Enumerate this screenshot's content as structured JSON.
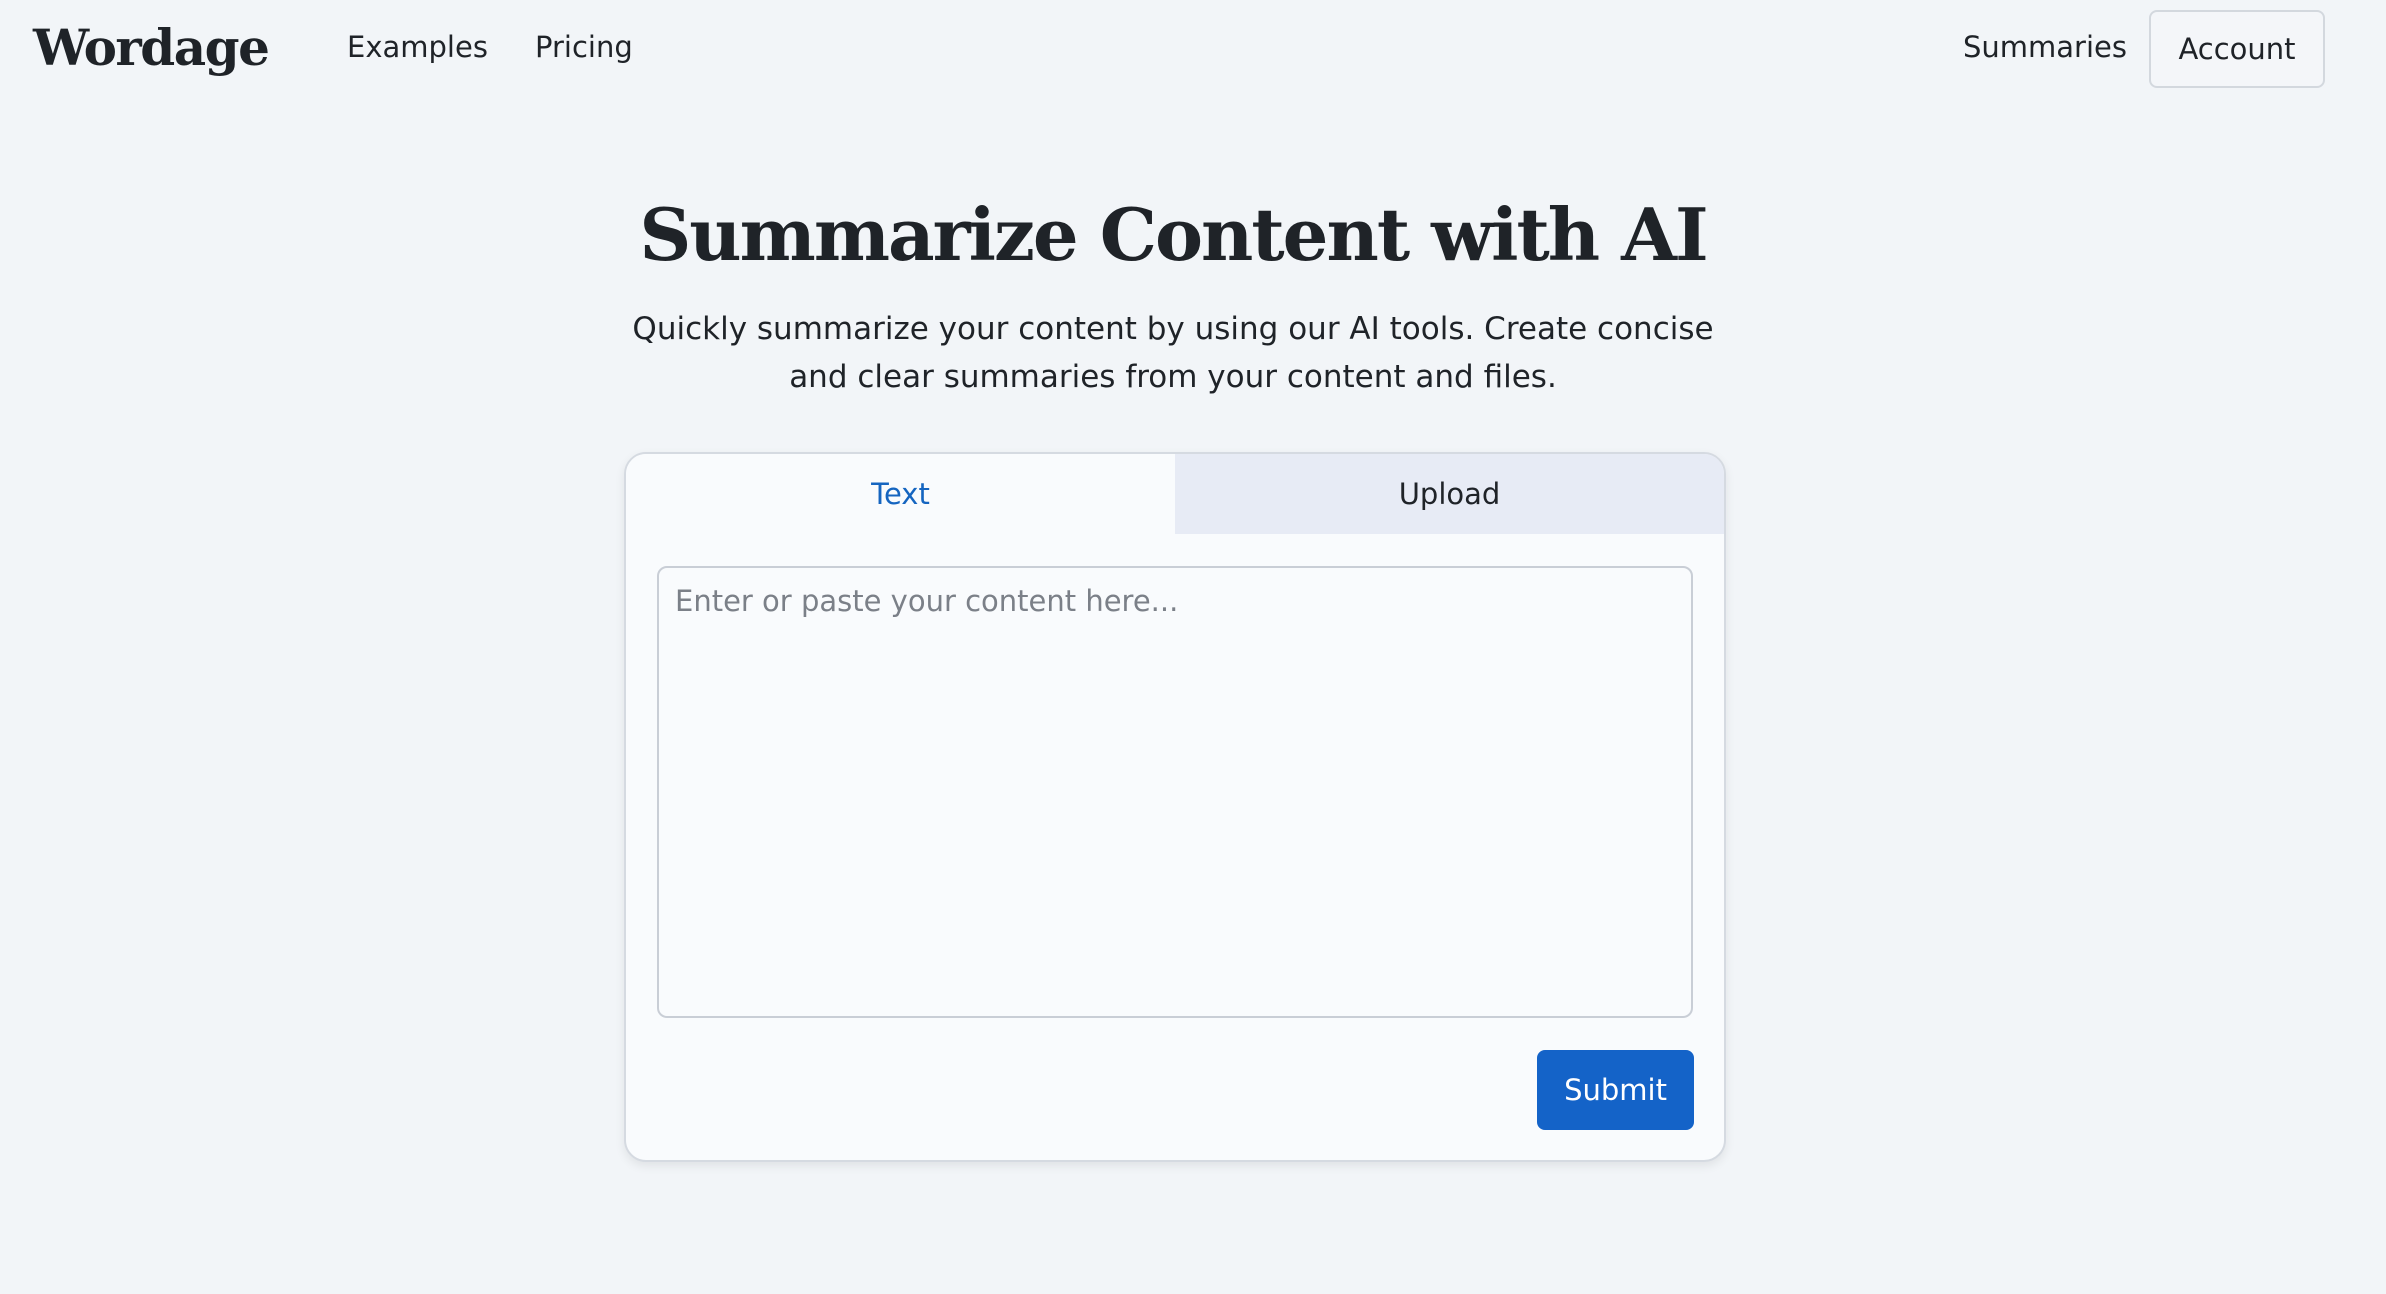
{
  "brand": {
    "logo": "Wordage"
  },
  "nav": {
    "left": [
      {
        "label": "Examples"
      },
      {
        "label": "Pricing"
      }
    ],
    "summaries_label": "Summaries",
    "account_label": "Account"
  },
  "hero": {
    "title": "Summarize Content with AI",
    "subtitle": "Quickly summarize your content by using our AI tools. Create concise and clear summaries from your content and files."
  },
  "card": {
    "tabs": [
      {
        "label": "Text",
        "active": true
      },
      {
        "label": "Upload",
        "active": false
      }
    ],
    "input": {
      "value": "",
      "placeholder": "Enter or paste your content here..."
    },
    "submit_label": "Submit"
  },
  "colors": {
    "background": "#f2f5f8",
    "accent": "#1463c8",
    "active_tab_text": "#1565c0",
    "inactive_tab_bg": "#e7ebf5",
    "text": "#1f2328"
  }
}
